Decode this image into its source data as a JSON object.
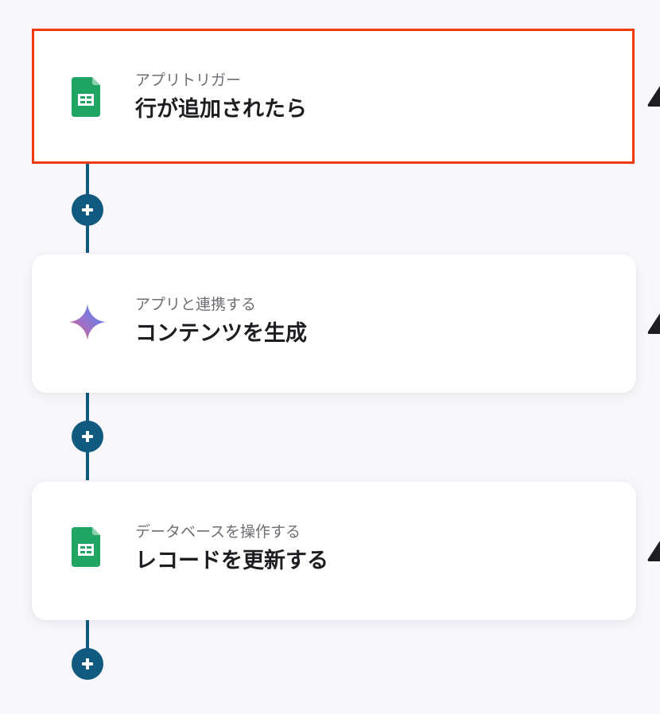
{
  "flow": {
    "steps": [
      {
        "subtitle": "アプリトリガー",
        "title": "行が追加されたら",
        "icon": "google-sheets-icon",
        "selected": true
      },
      {
        "subtitle": "アプリと連携する",
        "title": "コンテンツを生成",
        "icon": "gemini-sparkle-icon",
        "selected": false
      },
      {
        "subtitle": "データベースを操作する",
        "title": "レコードを更新する",
        "icon": "google-sheets-icon",
        "selected": false
      }
    ],
    "add_step_icon": "plus-icon"
  },
  "colors": {
    "background": "#f8f7fb",
    "connector": "#0f5a7e",
    "selected_border": "#f03a12",
    "sheets_green": "#1fa463",
    "card_background": "#ffffff"
  }
}
